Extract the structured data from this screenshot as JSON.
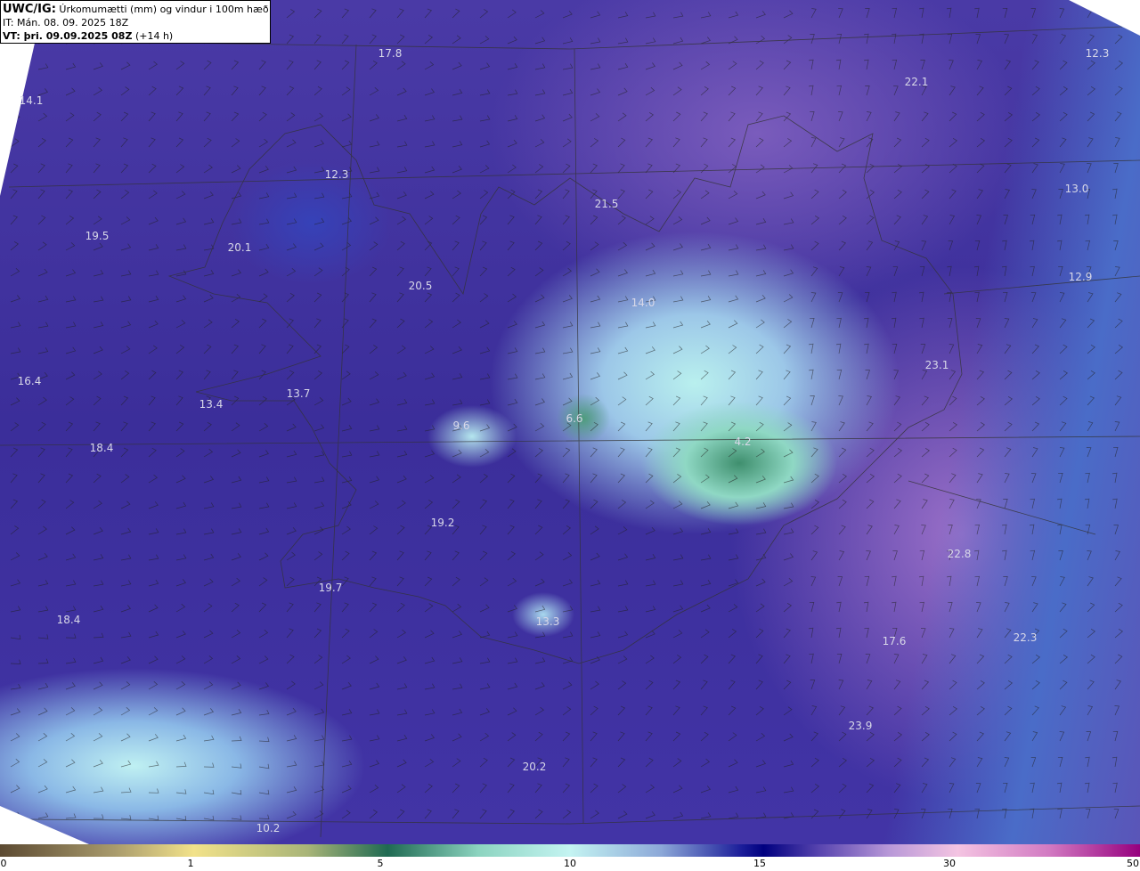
{
  "header": {
    "model": "UWC/IG:",
    "title": "Úrkomumætti (mm) og vindur i 100m hæð",
    "init": "IT: Mán. 08. 09. 2025 18Z",
    "valid_bold": "VT: þri. 09.09.2025 08Z",
    "valid_offset": "(+14 h)"
  },
  "labels": [
    "17.8",
    "14.1",
    "12.3",
    "22.1",
    "12.3",
    "21.5",
    "13.0",
    "19.5",
    "20.1",
    "20.5",
    "14.0",
    "12.9",
    "23.1",
    "16.4",
    "13.4",
    "13.7",
    "9.6",
    "6.6",
    "4.2",
    "18.4",
    "19.2",
    "22.8",
    "19.7",
    "18.4",
    "13.3",
    "17.6",
    "22.3",
    "23.9",
    "20.2",
    "10.2"
  ],
  "colorbar": {
    "ticks": [
      "0",
      "1",
      "5",
      "10",
      "15",
      "30",
      "50"
    ],
    "unit": "mm"
  }
}
